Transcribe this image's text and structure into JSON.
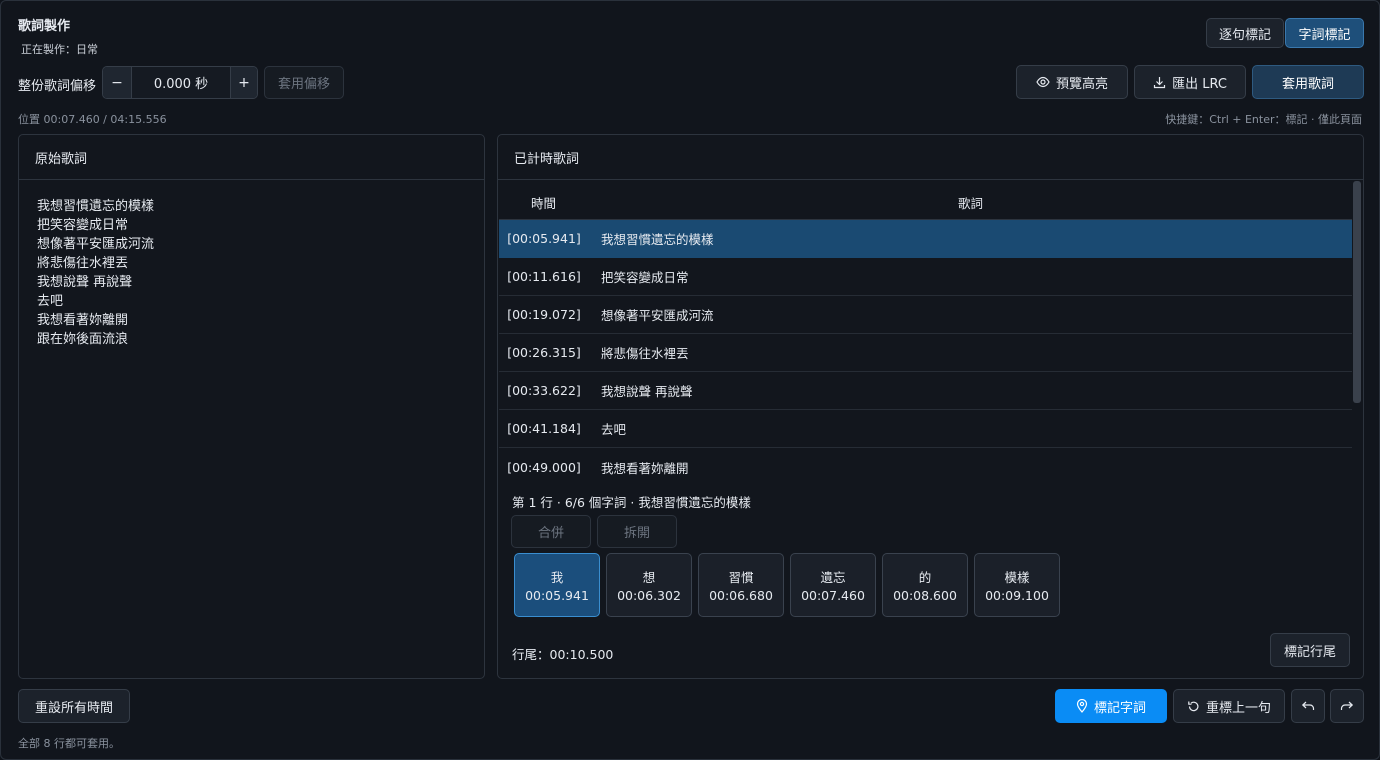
{
  "header": {
    "title": "歌詞製作",
    "subtitle": "正在製作：日常",
    "mode_line": "逐句標記",
    "mode_word": "字詞標記"
  },
  "offset": {
    "label": "整份歌詞偏移",
    "minus": "−",
    "value": "0.000 秒",
    "plus": "+",
    "apply": "套用偏移"
  },
  "toolbar": {
    "preview": "預覽高亮",
    "export": "匯出 LRC",
    "apply_lyrics": "套用歌詞"
  },
  "status": {
    "position": "位置 00:07.460 / 04:15.556",
    "shortcut": "快捷鍵：Ctrl + Enter：標記 · 僅此頁面"
  },
  "original": {
    "title": "原始歌詞",
    "lines": [
      "我想習慣遺忘的模樣",
      "把笑容變成日常",
      "想像著平安匯成河流",
      "將悲傷往水裡丟",
      "我想說聲 再說聲",
      "去吧",
      "我想看著妳離開",
      "跟在妳後面流浪"
    ]
  },
  "timed": {
    "title": "已計時歌詞",
    "col_time": "時間",
    "col_lyrics": "歌詞",
    "rows": [
      {
        "time": "[00:05.941]",
        "text": "我想習慣遺忘的模樣"
      },
      {
        "time": "[00:11.616]",
        "text": "把笑容變成日常"
      },
      {
        "time": "[00:19.072]",
        "text": "想像著平安匯成河流"
      },
      {
        "time": "[00:26.315]",
        "text": "將悲傷往水裡丟"
      },
      {
        "time": "[00:33.622]",
        "text": "我想說聲 再說聲"
      },
      {
        "time": "[00:41.184]",
        "text": "去吧"
      },
      {
        "time": "[00:49.000]",
        "text": "我想看著妳離開"
      }
    ],
    "selected_index": 0
  },
  "word_editor": {
    "info": "第 1 行 · 6/6 個字詞 · 我想習慣遺忘的模樣",
    "merge": "合併",
    "split": "拆開",
    "words": [
      {
        "word": "我",
        "time": "00:05.941"
      },
      {
        "word": "想",
        "time": "00:06.302"
      },
      {
        "word": "習慣",
        "time": "00:06.680"
      },
      {
        "word": "遺忘",
        "time": "00:07.460"
      },
      {
        "word": "的",
        "time": "00:08.600"
      },
      {
        "word": "模樣",
        "time": "00:09.100"
      }
    ],
    "line_end": "行尾：00:10.500",
    "mark_line_end": "標記行尾"
  },
  "footer": {
    "reset_all": "重設所有時間",
    "note": "全部 8 行都可套用。",
    "mark_word": "標記字詞",
    "remark_prev": "重標上一句"
  },
  "colors": {
    "accent": "#0a8cf5",
    "selected_row": "#1a4a72",
    "background": "#11151c"
  }
}
